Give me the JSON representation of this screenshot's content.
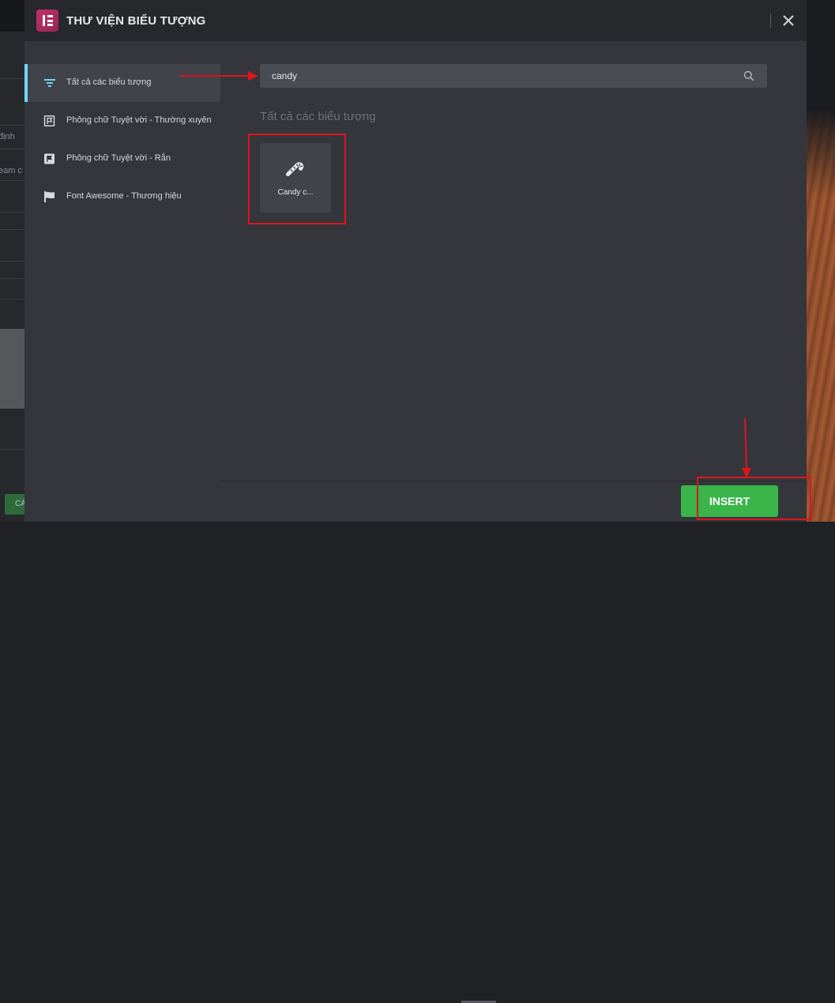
{
  "background": {
    "left_labels": [
      "định",
      "eam c"
    ],
    "left_button_label": "CÁ"
  },
  "modal": {
    "title": "THƯ VIỆN BIỂU TƯỢNG",
    "close_icon": "close-icon",
    "logo_icon": "elementor-logo-icon"
  },
  "sidebar": {
    "items": [
      {
        "label": "Tất cả các biểu tượng",
        "icon": "filter-lines-icon",
        "active": true
      },
      {
        "label": "Phông chữ Tuyệt vời - Thường xuyên",
        "icon": "flag-regular-icon",
        "active": false
      },
      {
        "label": "Phông chữ Tuyệt vời - Rắn",
        "icon": "flag-solid-icon",
        "active": false
      },
      {
        "label": "Font Awesome - Thương hiệu",
        "icon": "flag-brands-icon",
        "active": false
      }
    ]
  },
  "search": {
    "value": "candy",
    "icon": "search-icon"
  },
  "results": {
    "section_title": "Tất cả các biểu tượng",
    "icons": [
      {
        "label": "Candy c...",
        "icon": "candy-cane-icon"
      }
    ]
  },
  "footer": {
    "insert_label": "INSERT"
  },
  "colors": {
    "accent_active": "#71d7f7",
    "insert_green": "#39b54a",
    "logo_pink": "#c2306c",
    "annotation_red": "#e0141b"
  }
}
